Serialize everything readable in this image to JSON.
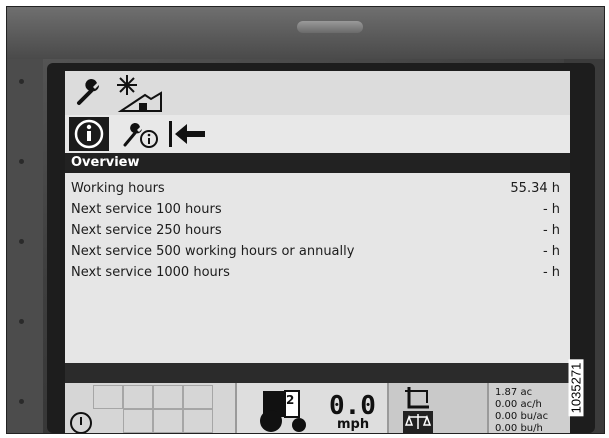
{
  "screen": {
    "header": "Overview",
    "rows": [
      {
        "label": "Working hours",
        "value": "55.34 h"
      },
      {
        "label": "Next service 100 hours",
        "value": "- h"
      },
      {
        "label": "Next service 250 hours",
        "value": "- h"
      },
      {
        "label": "Next service 500 working hours or annually",
        "value": "- h"
      },
      {
        "label": "Next service 1000 hours",
        "value": "- h"
      }
    ],
    "tabs_row1": [
      "wrench-icon",
      "sun-field-icon"
    ],
    "tabs_row2": [
      "info-icon",
      "service-info-icon",
      "back-arrow-icon"
    ]
  },
  "status": {
    "gear": "2",
    "speed": "0.0",
    "speed_unit": "mph",
    "area": "1.87 ac",
    "area_rate": "0.00 ac/h",
    "yield": "0.00 bu/ac",
    "yield_rate": "0.00 bu/h"
  },
  "figure_ref": "1035271"
}
